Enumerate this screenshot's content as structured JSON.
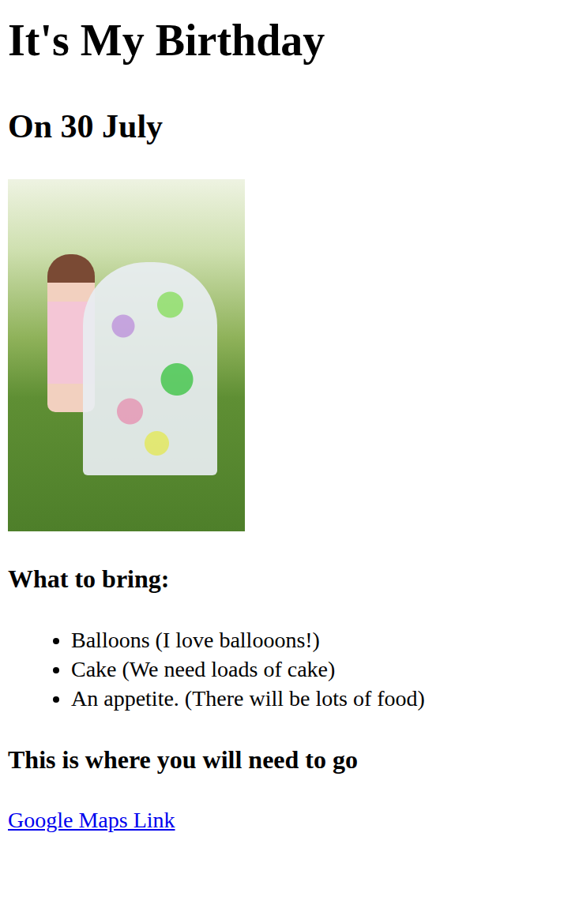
{
  "title": "It's My Birthday",
  "date": "On 30 July",
  "bring": {
    "title": "What to bring:",
    "items": [
      "Balloons (I love ballooons!)",
      "Cake (We need loads of cake)",
      "An appetite. (There will be lots of food)"
    ]
  },
  "location": {
    "title": "This is where you will need to go",
    "link": "Google Maps Link"
  }
}
